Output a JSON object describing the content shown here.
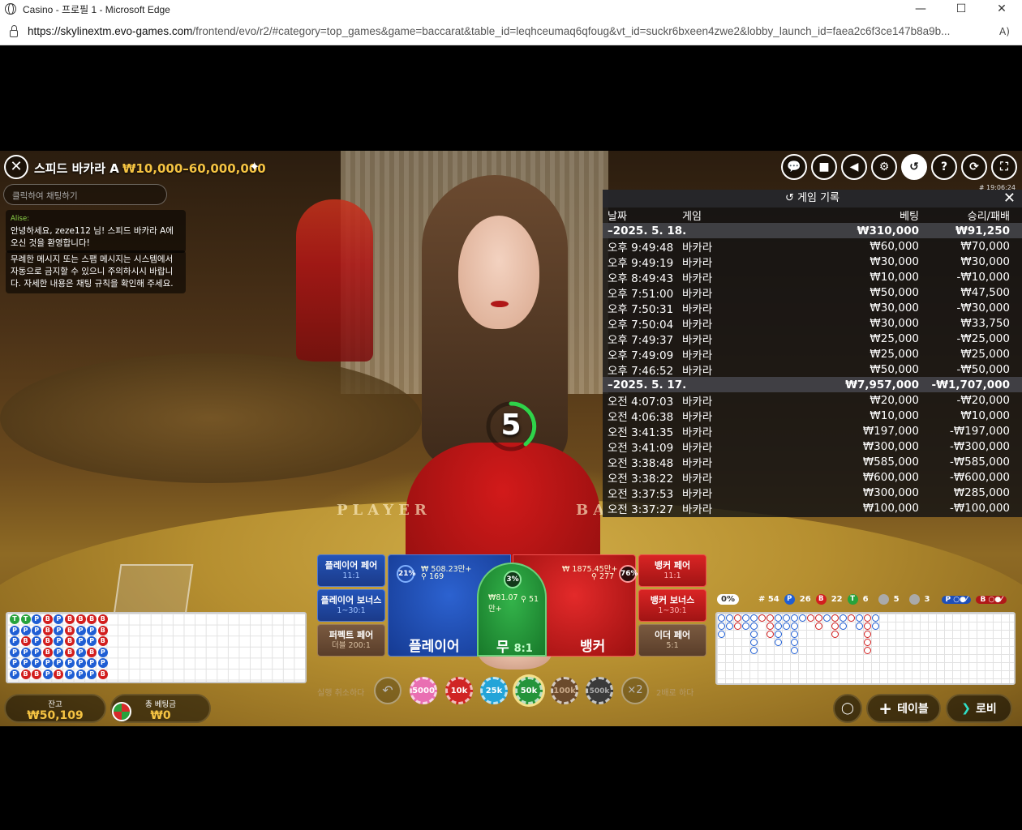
{
  "window": {
    "title": "Casino - 프로필 1 - Microsoft Edge",
    "min": "—",
    "max": "☐",
    "close": "✕"
  },
  "urlbar": {
    "host": "https://skylinextm.evo-games.com",
    "rest": "/frontend/evo/r2/#category=top_games&game=baccarat&table_id=leqhceumaq6qfoug&vt_id=suckr6bxeen4zwe2&lobby_launch_id=faea2c6f3ce147b8a9b...",
    "read_aloud": "A)"
  },
  "game": {
    "table_name": "스피드 바카라 A",
    "limits": "₩10,000–60,000,000",
    "chat_placeholder": "클릭하여 채팅하기",
    "chat": [
      {
        "author": "Alise:",
        "text": "안녕하세요, zeze112 님! 스피드 바카라 A에 오신 것을 환영합니다!"
      },
      {
        "author": "",
        "text": "무례한 메시지 또는 스팸 메시지는 시스템에서 자동으로 금지할 수 있으니 주의하시시 바랍니다. 자세한 내용은 채팅 규칙을 확인해 주세요."
      }
    ],
    "clock": "# 19:06:24",
    "countdown": "5",
    "table_text_player": "PLAYER",
    "table_text_banker": "BA"
  },
  "history": {
    "title": "게임 기록",
    "headers": [
      "날짜",
      "게임",
      "베팅",
      "승리/패배"
    ],
    "rows": [
      {
        "type": "day",
        "date": "–2025. 5. 18.",
        "game": "",
        "bet": "₩310,000",
        "result": "₩91,250"
      },
      {
        "type": "row",
        "date": "오후 9:49:48",
        "game": "바카라",
        "bet": "₩60,000",
        "result": "₩70,000"
      },
      {
        "type": "row",
        "date": "오후 9:49:19",
        "game": "바카라",
        "bet": "₩30,000",
        "result": "₩30,000"
      },
      {
        "type": "row",
        "date": "오후 8:49:43",
        "game": "바카라",
        "bet": "₩10,000",
        "result": "-₩10,000"
      },
      {
        "type": "row",
        "date": "오후 7:51:00",
        "game": "바카라",
        "bet": "₩50,000",
        "result": "₩47,500"
      },
      {
        "type": "row",
        "date": "오후 7:50:31",
        "game": "바카라",
        "bet": "₩30,000",
        "result": "-₩30,000"
      },
      {
        "type": "row",
        "date": "오후 7:50:04",
        "game": "바카라",
        "bet": "₩30,000",
        "result": "₩33,750"
      },
      {
        "type": "row",
        "date": "오후 7:49:37",
        "game": "바카라",
        "bet": "₩25,000",
        "result": "-₩25,000"
      },
      {
        "type": "row",
        "date": "오후 7:49:09",
        "game": "바카라",
        "bet": "₩25,000",
        "result": "₩25,000"
      },
      {
        "type": "row",
        "date": "오후 7:46:52",
        "game": "바카라",
        "bet": "₩50,000",
        "result": "-₩50,000"
      },
      {
        "type": "day",
        "date": "–2025. 5. 17.",
        "game": "",
        "bet": "₩7,957,000",
        "result": "-₩1,707,000"
      },
      {
        "type": "row",
        "date": "오전 4:07:03",
        "game": "바카라",
        "bet": "₩20,000",
        "result": "-₩20,000"
      },
      {
        "type": "row",
        "date": "오전 4:06:38",
        "game": "바카라",
        "bet": "₩10,000",
        "result": "₩10,000"
      },
      {
        "type": "row",
        "date": "오전 3:41:35",
        "game": "바카라",
        "bet": "₩197,000",
        "result": "-₩197,000"
      },
      {
        "type": "row",
        "date": "오전 3:41:09",
        "game": "바카라",
        "bet": "₩300,000",
        "result": "-₩300,000"
      },
      {
        "type": "row",
        "date": "오전 3:38:48",
        "game": "바카라",
        "bet": "₩585,000",
        "result": "-₩585,000"
      },
      {
        "type": "row",
        "date": "오전 3:38:22",
        "game": "바카라",
        "bet": "₩600,000",
        "result": "-₩600,000"
      },
      {
        "type": "row",
        "date": "오전 3:37:53",
        "game": "바카라",
        "bet": "₩300,000",
        "result": "₩285,000"
      },
      {
        "type": "row",
        "date": "오전 3:37:27",
        "game": "바카라",
        "bet": "₩100,000",
        "result": "-₩100,000"
      }
    ]
  },
  "bets": {
    "player_pair": {
      "label": "플레이어 페어",
      "odds": "11:1"
    },
    "player_bonus": {
      "label": "플레이어 보너스",
      "odds": "1~30:1"
    },
    "perfect_pair": {
      "label": "퍼펙트 페어",
      "odds": "더블 200:1"
    },
    "banker_pair": {
      "label": "뱅커 페어",
      "odds": "11:1"
    },
    "banker_bonus": {
      "label": "뱅커 보너스",
      "odds": "1~30:1"
    },
    "either_pair": {
      "label": "이더 페어",
      "odds": "5:1"
    },
    "player": {
      "label": "플레이어",
      "pct": "21%",
      "amount": "₩ 508.23만+",
      "players": "169"
    },
    "tie": {
      "label": "무",
      "odds": "8:1",
      "pct": "3%",
      "amount": "₩81.07만+",
      "players": "51"
    },
    "banker": {
      "label": "뱅커",
      "pct": "76%",
      "amount": "₩ 1875.45만+",
      "players": "277"
    }
  },
  "chips": {
    "undo": "실행 취소하다",
    "double": "2배로 하다",
    "double_symbol": "×2",
    "values": [
      "5000",
      "10k",
      "25k",
      "50k",
      "100k",
      "500k"
    ],
    "selected": "50k"
  },
  "stats": {
    "progress": "0%",
    "round": "# 54",
    "p": "26",
    "b": "22",
    "t": "6",
    "pp": "5",
    "bp": "3"
  },
  "bottom": {
    "balance_label": "잔고",
    "balance": "₩50,109",
    "total_label": "총 베팅금",
    "total": "₩0",
    "table_btn": "테이블",
    "lobby_btn": "로비"
  },
  "colors": {
    "gold": "#f5c342",
    "player_blue": "#1f4fb8",
    "banker_red": "#d21e1e",
    "tie_green": "#27a33c"
  }
}
